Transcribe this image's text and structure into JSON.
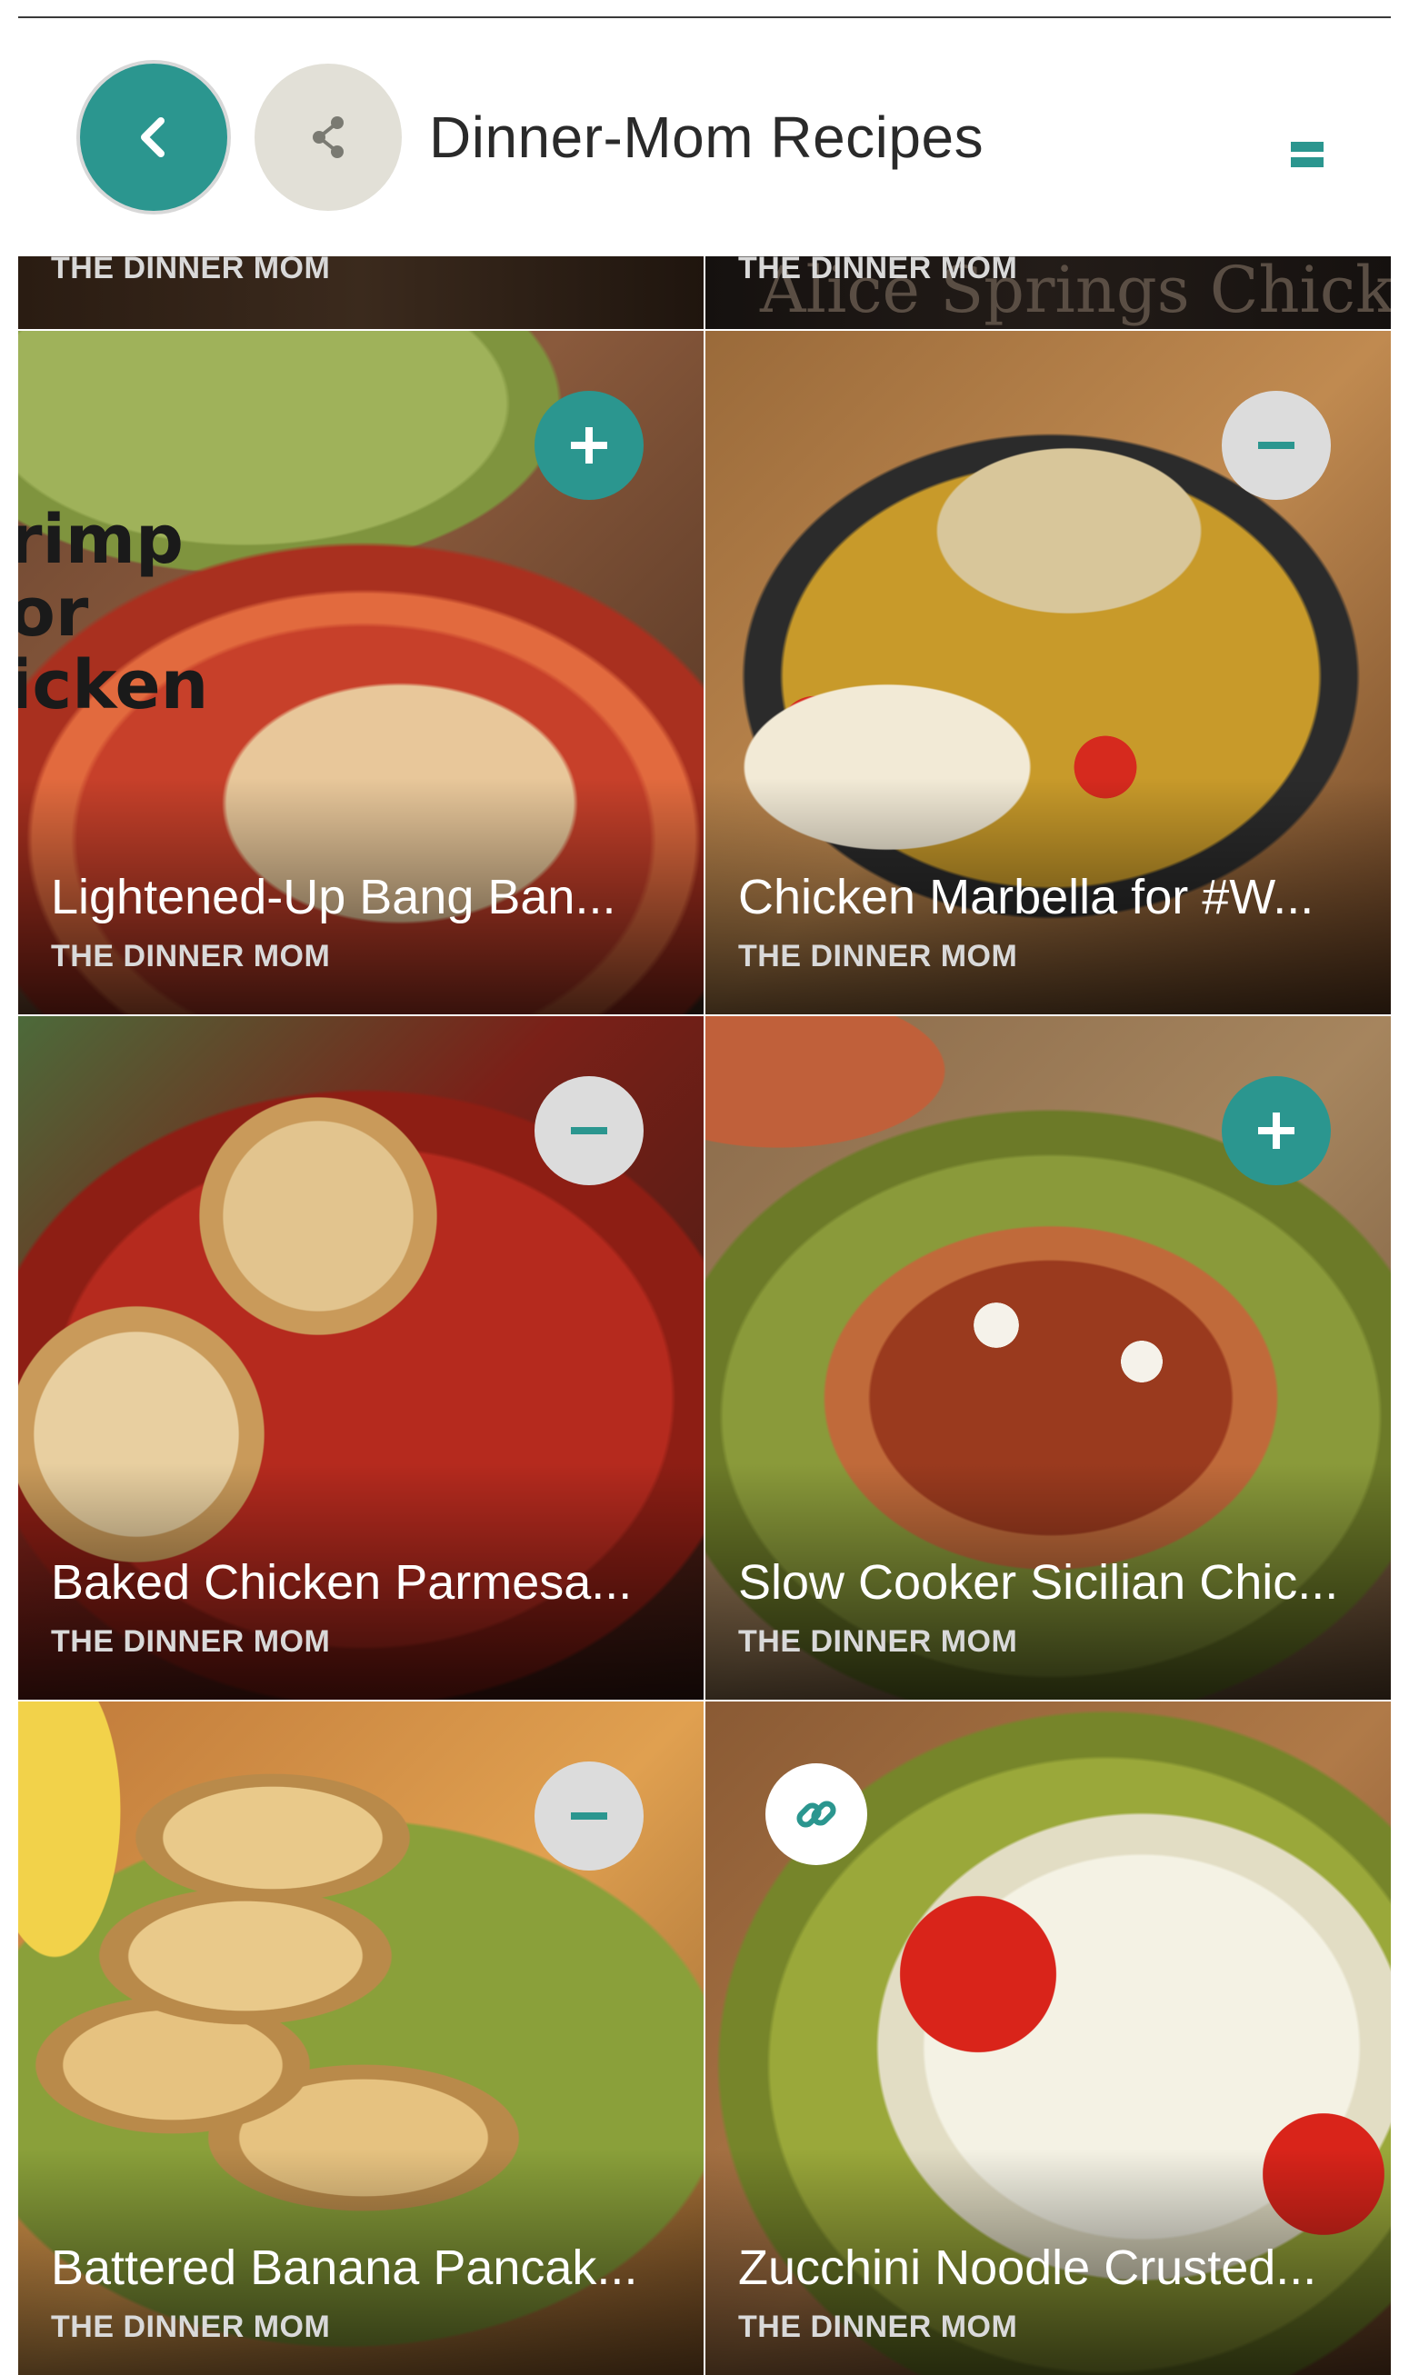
{
  "header": {
    "title": "Dinner-Mom Recipes",
    "back_icon": "chevron-left-icon",
    "share_icon": "share-icon",
    "menu_icon": "menu-icon"
  },
  "colors": {
    "accent": "#2b968f",
    "remove_bg": "#dcdcdc",
    "share_bg": "#e2e0d7"
  },
  "top_strip": [
    {
      "source": "THE DINNER MOM",
      "overlay_text": ""
    },
    {
      "source": "THE DINNER MOM",
      "overlay_text": "Alice Springs Chicken"
    }
  ],
  "recipes": [
    {
      "name": "Lightened-Up Bang Ban...",
      "source": "THE DINNER MOM",
      "action": "add",
      "action_icon": "plus-icon",
      "photo_text": "rimp\nor\nicken"
    },
    {
      "name": "Chicken Marbella for #W...",
      "source": "THE DINNER MOM",
      "action": "remove",
      "action_icon": "minus-icon",
      "photo_text": ""
    },
    {
      "name": "Baked Chicken Parmesa...",
      "source": "THE DINNER MOM",
      "action": "remove",
      "action_icon": "minus-icon",
      "photo_text": ""
    },
    {
      "name": "Slow Cooker Sicilian Chic...",
      "source": "THE DINNER MOM",
      "action": "add",
      "action_icon": "plus-icon",
      "photo_text": ""
    },
    {
      "name": "Battered Banana Pancak...",
      "source": "THE DINNER MOM",
      "action": "remove",
      "action_icon": "minus-icon",
      "photo_text": ""
    },
    {
      "name": "Zucchini Noodle Crusted...",
      "source": "THE DINNER MOM",
      "action": "link",
      "action_icon": "link-icon",
      "photo_text": ""
    }
  ]
}
